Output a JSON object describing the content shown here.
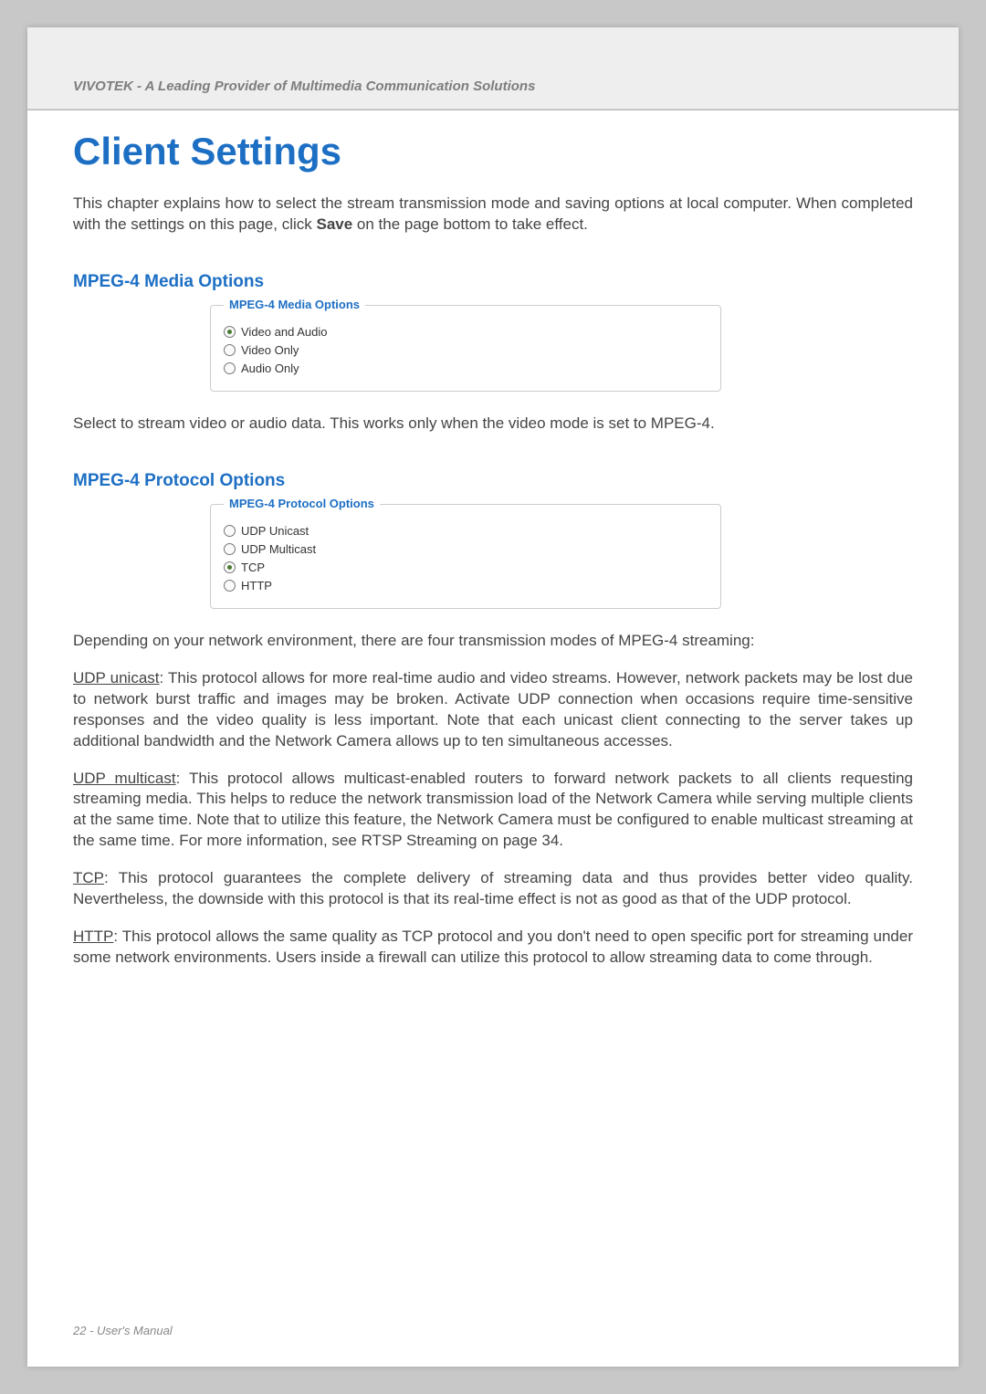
{
  "header": {
    "brandline": "VIVOTEK - A Leading Provider of Multimedia Communication Solutions"
  },
  "title": "Client Settings",
  "intro_pre": "This chapter explains how to select the stream transmission mode and saving options at local computer. When completed with the settings on this page, click ",
  "intro_bold": "Save",
  "intro_post": " on the page bottom to take effect.",
  "media": {
    "heading": "MPEG-4 Media Options",
    "legend": "MPEG-4 Media Options",
    "options": {
      "o1": "Video and Audio",
      "o2": "Video Only",
      "o3": "Audio Only"
    },
    "note": "Select to stream video or audio data. This works only when the video mode is set to MPEG-4."
  },
  "protocol": {
    "heading": "MPEG-4 Protocol Options",
    "legend": "MPEG-4 Protocol Options",
    "options": {
      "o1": "UDP Unicast",
      "o2": "UDP Multicast",
      "o3": "TCP",
      "o4": "HTTP"
    },
    "intro": "Depending on your network environment, there are four transmission modes of MPEG-4 streaming:",
    "udp_unicast_label": "UDP unicast",
    "udp_unicast_body": ": This protocol allows for more real-time audio and video streams. However, network packets may be lost due to network burst traffic and images may be broken. Activate UDP connection when occasions require time-sensitive responses and the video quality is less important. Note that each unicast client connecting to the server takes up additional bandwidth and the Network Camera allows up to ten simultaneous accesses.",
    "udp_multicast_label": "UDP multicast",
    "udp_multicast_body": ": This protocol allows multicast-enabled routers to forward network packets to all clients requesting streaming media. This helps to reduce the network transmission load of the Network Camera while serving multiple clients at the same time. Note that to utilize this feature, the Network Camera must be configured to enable multicast streaming at the same time. For more information, see RTSP Streaming on page 34.",
    "tcp_label": "TCP",
    "tcp_body": ": This protocol guarantees the complete delivery of streaming data and thus provides better video quality. Nevertheless, the downside with this protocol is that its real-time effect is not as good as that of the UDP protocol.",
    "http_label": "HTTP",
    "http_body": ": This protocol allows the same quality as TCP protocol and you don't need to open specific port for streaming under some network environments. Users inside a firewall can utilize this protocol to allow streaming data to come through."
  },
  "footer": "22 - User's Manual"
}
